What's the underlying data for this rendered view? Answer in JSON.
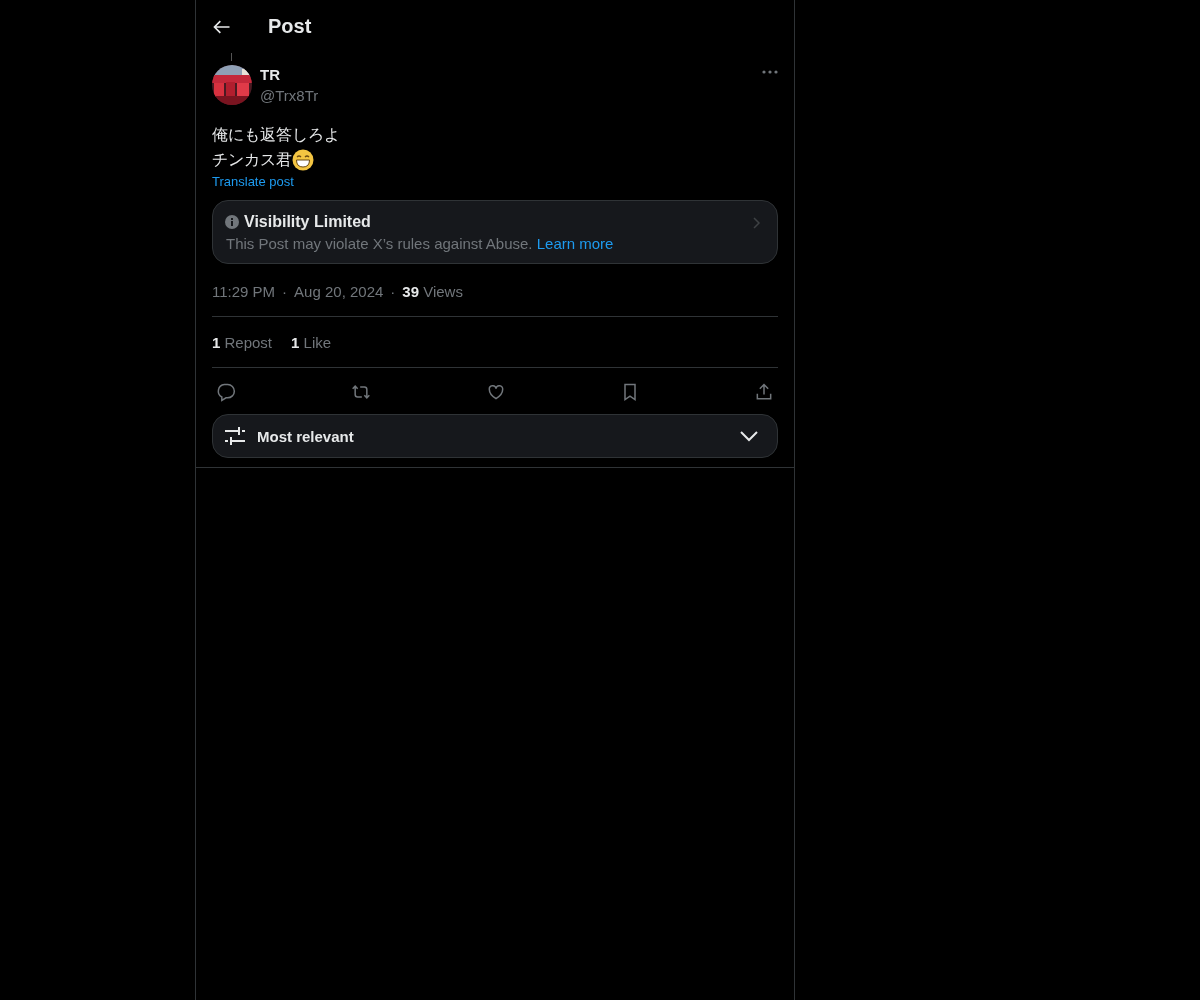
{
  "header": {
    "title": "Post"
  },
  "post": {
    "author": {
      "name": "TR",
      "handle": "@Trx8Tr"
    },
    "text_lines": [
      "俺にも返答しろよ",
      "チンカス君"
    ],
    "translate": "Translate post",
    "notice": {
      "title": "Visibility Limited",
      "text": "This Post may violate X’s rules against Abuse.",
      "link": "Learn more"
    },
    "meta": [
      {
        "kind": "text",
        "text": "11:29 PM"
      },
      {
        "kind": "sep",
        "text": "·"
      },
      {
        "kind": "text",
        "text": "Aug 20, 2024"
      },
      {
        "kind": "sep",
        "text": "·"
      },
      {
        "kind": "count",
        "count": "39",
        "label": "Views"
      }
    ],
    "stats": [
      {
        "count": "1",
        "label": "Repost"
      },
      {
        "count": "1",
        "label": "Like"
      }
    ],
    "actions": [
      {
        "kind": "reply"
      },
      {
        "kind": "repost"
      },
      {
        "kind": "like"
      },
      {
        "kind": "bookmark"
      },
      {
        "kind": "share"
      }
    ]
  },
  "sort": {
    "label": "Most relevant"
  }
}
